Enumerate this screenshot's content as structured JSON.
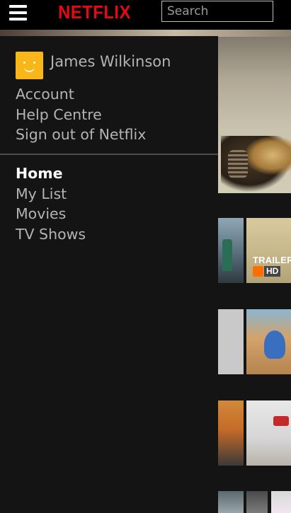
{
  "header": {
    "menu_icon": "hamburger-menu-icon",
    "logo": "NETFLIX",
    "search_placeholder": "Search",
    "search_value": ""
  },
  "colors": {
    "brand_red": "#e50914",
    "background": "#141414",
    "avatar": "#f8b619",
    "menu_text": "#b3b3b3",
    "menu_active": "#ffffff"
  },
  "menu": {
    "profile": {
      "name": "James Wilkinson",
      "avatar_icon": "smiley-avatar-icon"
    },
    "account_links": [
      {
        "label": "Account"
      },
      {
        "label": "Help Centre"
      },
      {
        "label": "Sign out of Netflix"
      }
    ],
    "nav_items": [
      {
        "label": "Home",
        "active": true
      },
      {
        "label": "My List",
        "active": false
      },
      {
        "label": "Movies",
        "active": false
      },
      {
        "label": "TV Shows",
        "active": false
      }
    ]
  },
  "content": {
    "thumbnail_badge": {
      "text": "TRAILER",
      "quality": "HD"
    }
  }
}
